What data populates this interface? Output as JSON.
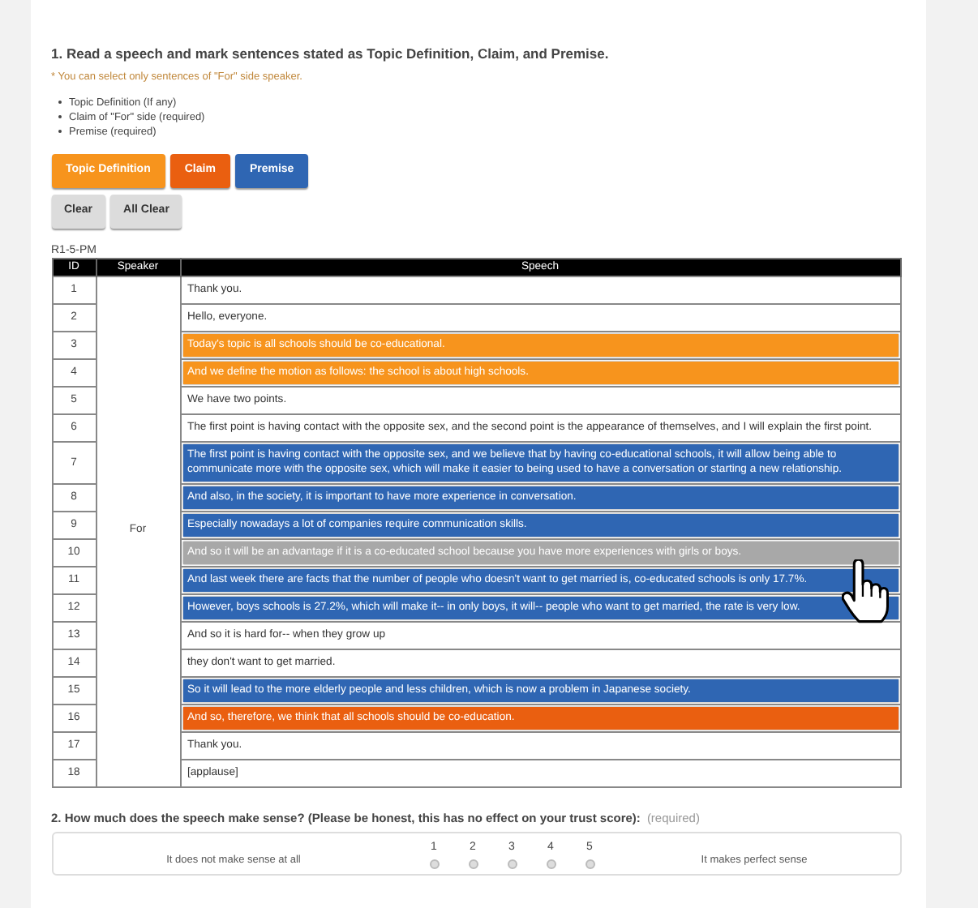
{
  "question1": {
    "title": "1. Read a speech and mark sentences stated as Topic Definition, Claim, and Premise.",
    "note": "* You can select only sentences of \"For\" side speaker.",
    "bullets": [
      "Topic Definition (If any)",
      "Claim of \"For\" side (required)",
      "Premise (required)"
    ]
  },
  "label_buttons": [
    {
      "label": "Topic Definition",
      "kind": "topic"
    },
    {
      "label": "Claim",
      "kind": "claim"
    },
    {
      "label": "Premise",
      "kind": "premise"
    }
  ],
  "action_buttons": [
    "Clear",
    "All Clear"
  ],
  "table": {
    "caption": "R1-5-PM",
    "columns": [
      "ID",
      "Speaker",
      "Speech"
    ],
    "speaker": "For",
    "rows": [
      {
        "id": "1",
        "text": "Thank you.",
        "kind": "none"
      },
      {
        "id": "2",
        "text": "Hello, everyone.",
        "kind": "none"
      },
      {
        "id": "3",
        "text": "Today's topic is all schools should be co-educational.",
        "kind": "topic"
      },
      {
        "id": "4",
        "text": "And we define the motion as follows: the school is about high schools.",
        "kind": "topic"
      },
      {
        "id": "5",
        "text": "We have two points.",
        "kind": "none"
      },
      {
        "id": "6",
        "text": "The first point is having contact with the opposite sex, and the second point is the appearance of themselves, and I will explain the first point.",
        "kind": "none"
      },
      {
        "id": "7",
        "text": "The first point is having contact with the opposite sex, and we believe that by having co-educational schools, it will allow being able to communicate more with the opposite sex, which will make it easier to being used to have a conversation or starting a new relationship.",
        "kind": "premise"
      },
      {
        "id": "8",
        "text": "And also, in the society, it is important to have more experience in conversation.",
        "kind": "premise"
      },
      {
        "id": "9",
        "text": "Especially nowadays a lot of companies require communication skills.",
        "kind": "premise"
      },
      {
        "id": "10",
        "text": "And so it will be an advantage if it is a co-educated school because you have more experiences with girls or boys.",
        "kind": "hover"
      },
      {
        "id": "11",
        "text": "And last week there are facts that the number of people who doesn't want to get married is, co-educated schools is only 17.7%.",
        "kind": "premise"
      },
      {
        "id": "12",
        "text": "However, boys schools is 27.2%, which will make it-- in only boys, it will-- people who want to get married, the rate is very low.",
        "kind": "premise"
      },
      {
        "id": "13",
        "text": "And so it is hard for-- when they grow up",
        "kind": "none"
      },
      {
        "id": "14",
        "text": "they don't want to get married.",
        "kind": "none"
      },
      {
        "id": "15",
        "text": "So it will lead to the more elderly people and less children, which is now a problem in Japanese society.",
        "kind": "premise"
      },
      {
        "id": "16",
        "text": "And so, therefore, we think that all schools should be co-education.",
        "kind": "claim"
      },
      {
        "id": "17",
        "text": "Thank you.",
        "kind": "none"
      },
      {
        "id": "18",
        "text": "[applause]",
        "kind": "none"
      }
    ]
  },
  "question2": {
    "title": "2. How much does the speech make sense? (Please be honest, this has no effect on your trust score):",
    "required": "(required)",
    "low_label": "It does not make sense at all",
    "high_label": "It makes perfect sense",
    "options": [
      {
        "label": "1",
        "selected": false
      },
      {
        "label": "2",
        "selected": false
      },
      {
        "label": "3",
        "selected": false
      },
      {
        "label": "4",
        "selected": false
      },
      {
        "label": "5",
        "selected": false
      }
    ]
  }
}
